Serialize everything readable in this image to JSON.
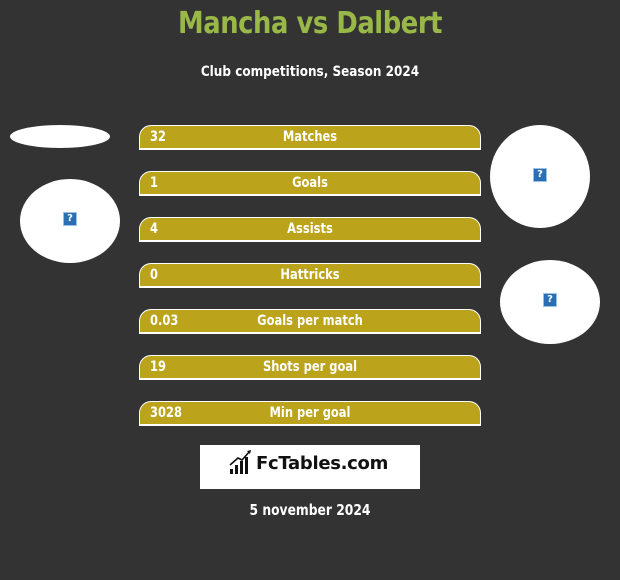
{
  "header": {
    "title": "Mancha vs Dalbert",
    "subtitle": "Club competitions, Season 2024"
  },
  "stats": [
    {
      "label": "Matches",
      "value": "32"
    },
    {
      "label": "Goals",
      "value": "1"
    },
    {
      "label": "Assists",
      "value": "4"
    },
    {
      "label": "Hattricks",
      "value": "0"
    },
    {
      "label": "Goals per match",
      "value": "0.03"
    },
    {
      "label": "Shots per goal",
      "value": "19"
    },
    {
      "label": "Min per goal",
      "value": "3028"
    }
  ],
  "images": {
    "placeholder_glyph": "?"
  },
  "logo": {
    "text": "FcTables.com",
    "icon": "bar-chart-trend-icon"
  },
  "footer": {
    "date": "5 november 2024"
  },
  "colors": {
    "background": "#333333",
    "title": "#99b847",
    "bar_fill": "#bba31b",
    "text": "#ffffff"
  }
}
